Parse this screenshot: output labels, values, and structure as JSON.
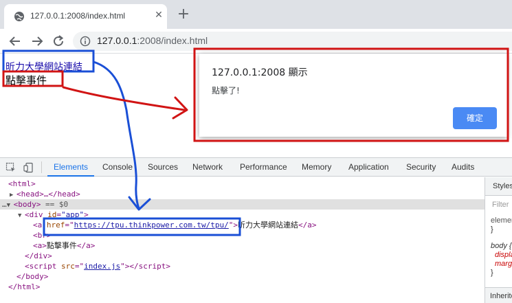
{
  "browser": {
    "tab_title": "127.0.0.1:2008/index.html",
    "close_glyph": "✕",
    "new_tab_glyph": "+",
    "url_host": "127.0.0.1",
    "url_rest": ":2008/index.html"
  },
  "page": {
    "link1": "昕力大學網站連結",
    "link2": "點擊事件"
  },
  "dialog": {
    "title": "127.0.0.1:2008 顯示",
    "message": "點擊了!",
    "ok_label": "確定"
  },
  "devtools": {
    "tabs": [
      "Elements",
      "Console",
      "Sources",
      "Network",
      "Performance",
      "Memory",
      "Application",
      "Security",
      "Audits"
    ],
    "active_tab": "Elements",
    "dom": {
      "html_open": "<html>",
      "head": "<head>…</head>",
      "body_open": "<body>",
      "body_marker": "== $0",
      "div_open_tag": "div",
      "div_attr": "id",
      "div_val": "\"app\"",
      "a1_attr": "href",
      "a1_val": "https://tpu.thinkpower.com.tw/tpu/",
      "a1_text": "昕力大學網站連結",
      "br": "<br>",
      "a2_text": "點擊事件",
      "div_close": "</div>",
      "script_src": "index.js",
      "body_close": "</body>",
      "html_close": "</html>"
    },
    "styles": {
      "tab": "Styles",
      "filter": "Filter",
      "rule1_selector": "element.style {",
      "rule_close": "}",
      "rule2_selector": "body {",
      "rule2_prop1": "display:",
      "rule2_prop2": "margin:",
      "inherited": "Inherited from"
    }
  },
  "annotation_colors": {
    "blue": "#1a4fd6",
    "red": "#d11414"
  }
}
